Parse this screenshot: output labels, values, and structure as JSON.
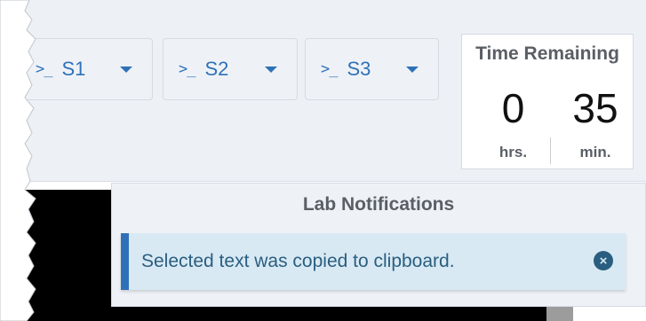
{
  "vms": [
    {
      "label": "S1",
      "icon": "terminal-prompt-icon",
      "prompt": ">_"
    },
    {
      "label": "S2",
      "icon": "terminal-prompt-icon",
      "prompt": ">_"
    },
    {
      "label": "S3",
      "icon": "terminal-prompt-icon",
      "prompt": ">_"
    }
  ],
  "timer": {
    "title": "Time Remaining",
    "hours": "0",
    "minutes": "35",
    "hours_unit": "hrs.",
    "minutes_unit": "min."
  },
  "notifications": {
    "title": "Lab Notifications",
    "message": "Selected text was copied to clipboard.",
    "dismiss_icon": "close-circle-icon"
  },
  "colors": {
    "accent": "#2f71b8",
    "header_bg": "#edf1f6",
    "alert_bg": "#d8e9f3",
    "alert_text": "#2a5e80"
  }
}
